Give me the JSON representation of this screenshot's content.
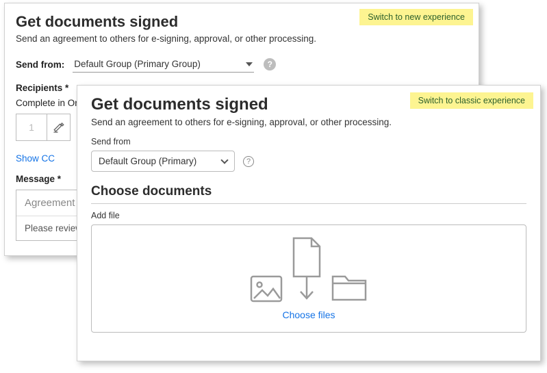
{
  "classic": {
    "title": "Get documents signed",
    "subtitle": "Send an agreement to others for e-signing, approval, or other processing.",
    "switch_label": "Switch to new experience",
    "send_from_label": "Send from:",
    "send_from_value": "Default Group (Primary Group)",
    "recipients_label": "Recipients",
    "complete_order_label": "Complete in Ord",
    "order_number": "1",
    "show_cc": "Show CC",
    "message_label": "Message",
    "agreement_placeholder": "Agreement N",
    "review_text": "Please review a"
  },
  "new": {
    "title": "Get documents signed",
    "subtitle": "Send an agreement to others for e-signing, approval, or other processing.",
    "switch_label": "Switch to classic experience",
    "send_from_label": "Send from",
    "send_from_value": "Default Group (Primary)",
    "choose_docs_heading": "Choose documents",
    "add_file_label": "Add file",
    "choose_files_label": "Choose files"
  }
}
